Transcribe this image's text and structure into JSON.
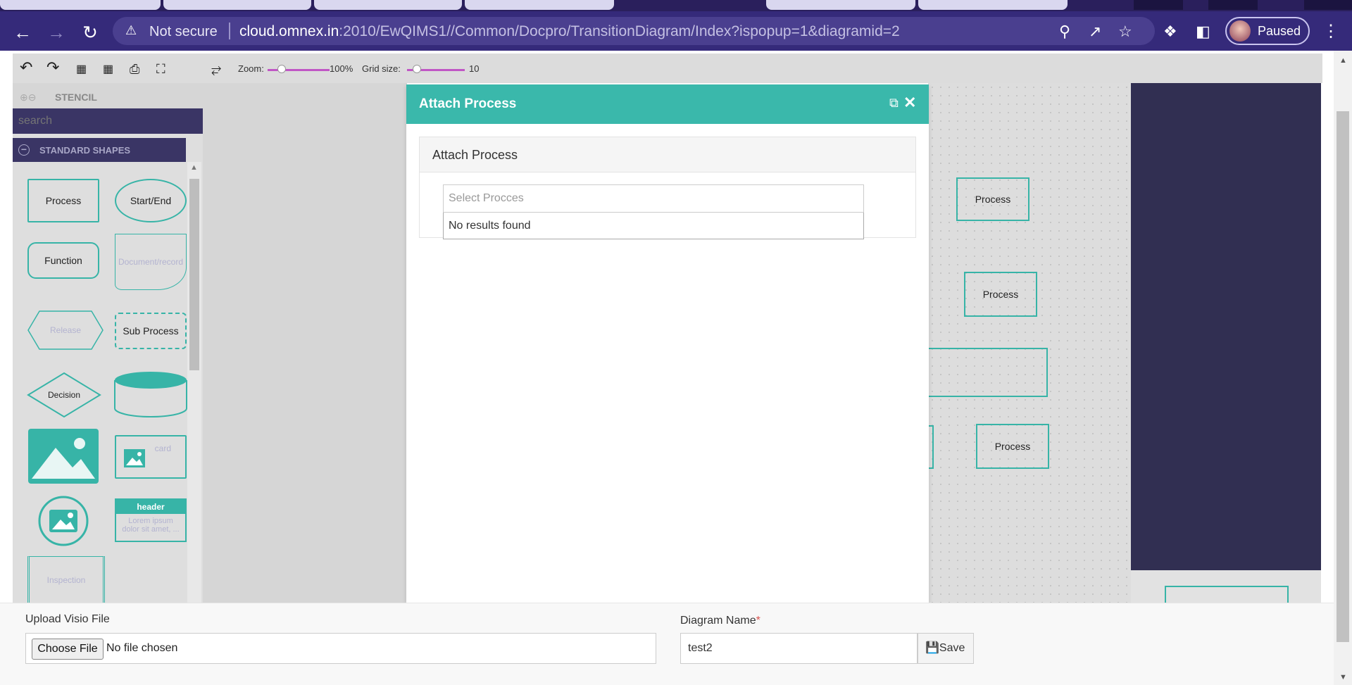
{
  "browser": {
    "security_label": "Not secure",
    "url_host": "cloud.omnex.in",
    "url_path": ":2010/EwQIMS1//Common/Docpro/TransitionDiagram/Index?ispopup=1&diagramid=2",
    "profile_status": "Paused"
  },
  "toolbar": {
    "zoom_label": "Zoom:",
    "zoom_value": "100%",
    "zoom_fraction": 1.0,
    "grid_label": "Grid size:",
    "grid_value": "10"
  },
  "stencil": {
    "title": "STENCIL",
    "search_placeholder": "search",
    "group_label": "STANDARD SHAPES",
    "shapes": {
      "process": "Process",
      "start_end": "Start/End",
      "function": "Function",
      "document": "Document/record",
      "release": "Release",
      "sub_process": "Sub Process",
      "decision": "Decision",
      "card": "card",
      "header": "header",
      "header_body": "Lorem ipsum dolor sit amet, ...",
      "inspection": "Inspection"
    }
  },
  "canvas": {
    "nodes": [
      "Process",
      "Process",
      "Process"
    ]
  },
  "modal": {
    "title": "Attach Process",
    "panel_title": "Attach Process",
    "select_placeholder": "Select Procces",
    "no_results": "No results found"
  },
  "form": {
    "upload_label": "Upload Visio File",
    "choose_file": "Choose File",
    "no_file": "No file chosen",
    "diagram_name_label": "Diagram Name",
    "required_mark": "*",
    "diagram_name_value": "test2",
    "save_label": "Save"
  },
  "colors": {
    "accent": "#3ab8ab",
    "browser_bar": "#352a7a",
    "stencil_dark": "#3a3565",
    "right_panel": "#312f52"
  }
}
